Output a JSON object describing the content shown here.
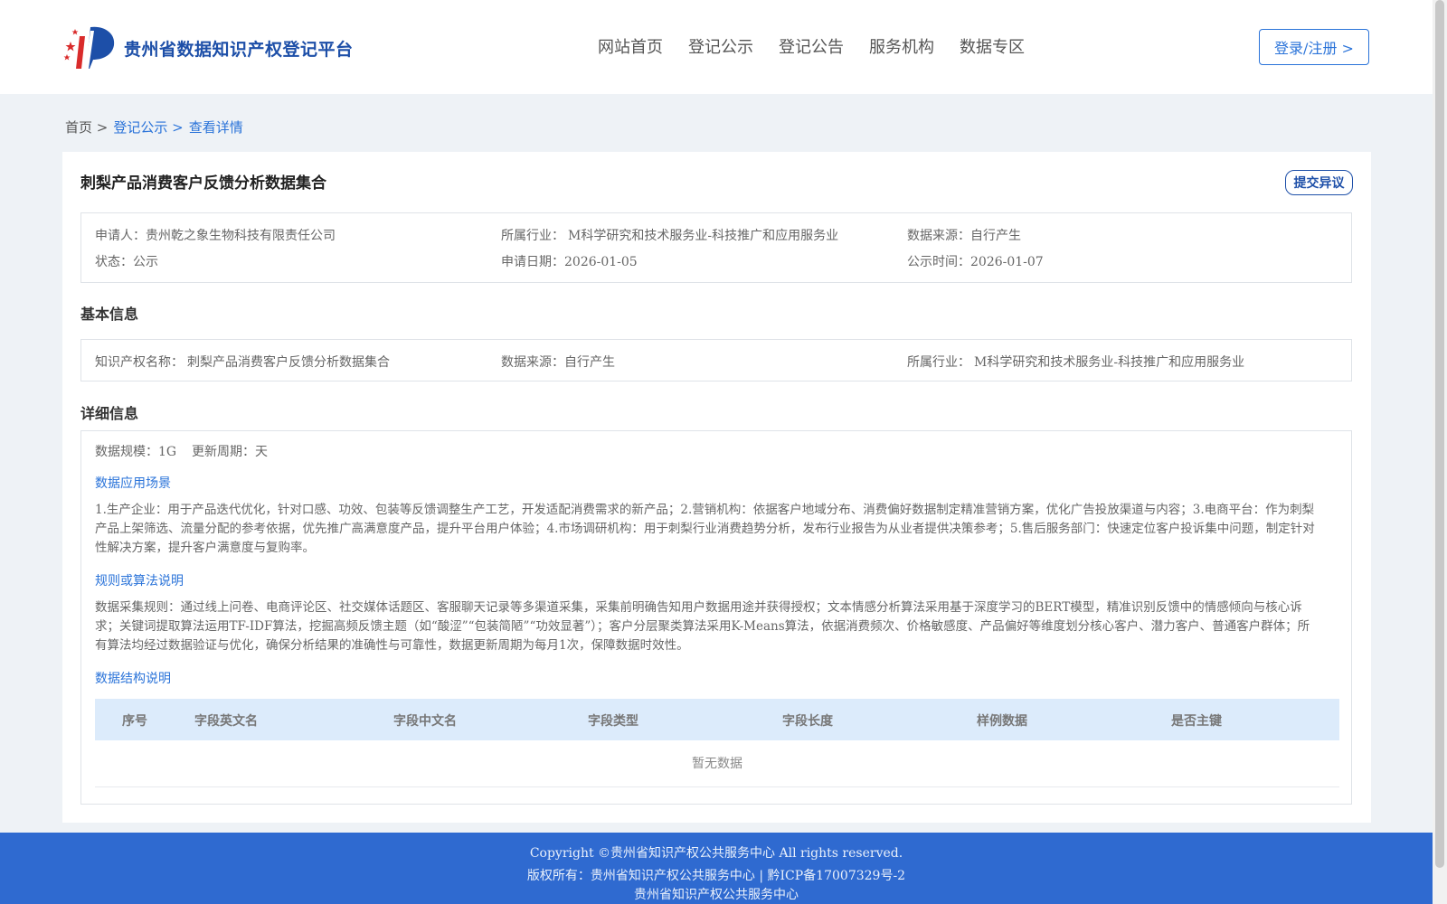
{
  "header": {
    "site_name": "贵州省数据知识产权登记平台",
    "nav": [
      "网站首页",
      "登记公示",
      "登记公告",
      "服务机构",
      "数据专区"
    ],
    "login_label": "登录/注册 >"
  },
  "breadcrumb": {
    "home": "首页 >",
    "level1": "登记公示 >",
    "current": "查看详情"
  },
  "detail": {
    "title": "刺梨产品消费客户反馈分析数据集合",
    "objection_label": "提交异议",
    "summary": {
      "applicant_label": "申请人：",
      "applicant": "贵州乾之象生物科技有限责任公司",
      "industry_label": "所属行业：",
      "industry": "M科学研究和技术服务业-科技推广和应用服务业",
      "source_label": "数据来源：",
      "source": "自行产生",
      "status_label": "状态：",
      "status": "公示",
      "apply_date_label": "申请日期：",
      "apply_date": "2026-01-05",
      "publish_date_label": "公示时间：",
      "publish_date": "2026-01-07"
    },
    "basic": {
      "heading": "基本信息",
      "ip_name_label": "知识产权名称：",
      "ip_name": "刺梨产品消费客户反馈分析数据集合",
      "source_label": "数据来源：",
      "source": "自行产生",
      "industry_label": "所属行业：",
      "industry": "M科学研究和技术服务业-科技推广和应用服务业"
    },
    "details": {
      "heading": "详细信息",
      "scale_label": "数据规模：",
      "scale": "1G",
      "cycle_label": "更新周期：",
      "cycle": "天",
      "scenario_heading": "数据应用场景",
      "scenario_text": "1.生产企业：用于产品迭代优化，针对口感、功效、包装等反馈调整生产工艺，开发适配消费需求的新产品；2.营销机构：依据客户地域分布、消费偏好数据制定精准营销方案，优化广告投放渠道与内容；3.电商平台：作为刺梨产品上架筛选、流量分配的参考依据，优先推广高满意度产品，提升平台用户体验；4.市场调研机构：用于刺梨行业消费趋势分析，发布行业报告为从业者提供决策参考；5.售后服务部门：快速定位客户投诉集中问题，制定针对性解决方案，提升客户满意度与复购率。",
      "algorithm_heading": "规则或算法说明",
      "algorithm_text": "数据采集规则：通过线上问卷、电商评论区、社交媒体话题区、客服聊天记录等多渠道采集，采集前明确告知用户数据用途并获得授权；文本情感分析算法采用基于深度学习的BERT模型，精准识别反馈中的情感倾向与核心诉求；关键词提取算法运用TF-IDF算法，挖掘高频反馈主题（如“酸涩”“包装简陋”“功效显著”）；客户分层聚类算法采用K-Means算法，依据消费频次、价格敏感度、产品偏好等维度划分核心客户、潜力客户、普通客户群体；所有算法均经过数据验证与优化，确保分析结果的准确性与可靠性，数据更新周期为每月1次，保障数据时效性。",
      "structure_heading": "数据结构说明",
      "table_columns": [
        "序号",
        "字段英文名",
        "字段中文名",
        "字段类型",
        "字段长度",
        "样例数据",
        "是否主键"
      ],
      "empty_text": "暂无数据"
    }
  },
  "footer": {
    "line1": "Copyright ©贵州省知识产权公共服务中心 All rights reserved.",
    "line2": "版权所有：贵州省知识产权公共服务中心 | 黔ICP备17007329号-2",
    "line3": "贵州省知识产权公共服务中心"
  }
}
